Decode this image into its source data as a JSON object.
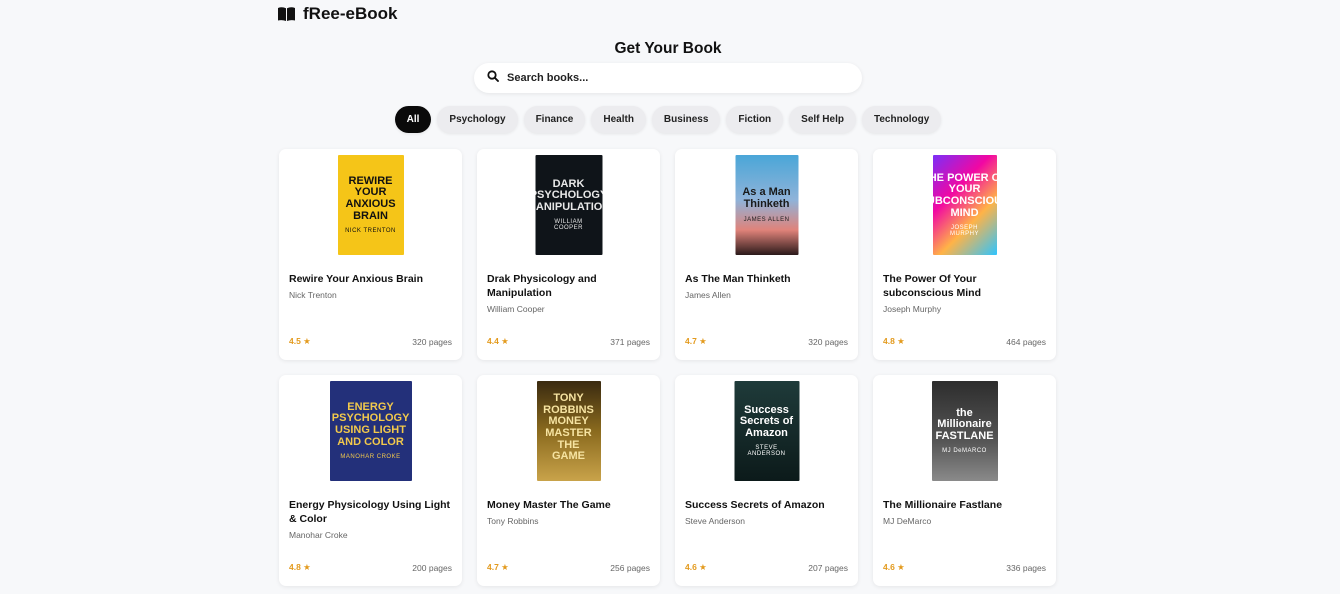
{
  "brand": {
    "name": "fRee-eBook",
    "icon": "book-open-icon"
  },
  "header": {
    "title": "Get Your Book"
  },
  "search": {
    "placeholder": "Search books...",
    "icon": "search-icon"
  },
  "filters": [
    "All",
    "Psychology",
    "Finance",
    "Health",
    "Business",
    "Fiction",
    "Self Help",
    "Technology"
  ],
  "active_filter": "All",
  "books": [
    {
      "title": "Rewire Your Anxious Brain",
      "author": "Nick Trenton",
      "rating": "4.5 ★",
      "pages": "320 pages",
      "cover": {
        "text": "REWIRE YOUR ANXIOUS BRAIN",
        "author": "NICK TRENTON",
        "bg": "#f5c518",
        "fg": "#111111"
      }
    },
    {
      "title": "Drak Physicology and Manipulation",
      "author": "William Cooper",
      "rating": "4.4 ★",
      "pages": "371 pages",
      "cover": {
        "text": "DARK PSYCHOLOGY MANIPULATION",
        "author": "WILLIAM COOPER",
        "bg": "#0f1419",
        "fg": "#e8e8e8"
      }
    },
    {
      "title": "As The Man Thinketh",
      "author": "James Allen",
      "rating": "4.7 ★",
      "pages": "320 pages",
      "cover": {
        "text": "As a Man Thinketh",
        "author": "JAMES ALLEN",
        "bg": "linear-gradient(180deg,#4aa6d8 0%,#8fb3d9 45%,#e0837a 75%,#2b1a1a 100%)",
        "fg": "#1a1a1a"
      }
    },
    {
      "title": "The Power Of Your subconscious Mind",
      "author": "Joseph Murphy",
      "rating": "4.8 ★",
      "pages": "464 pages",
      "cover": {
        "text": "THE POWER OF YOUR SUBCONSCIOUS MIND",
        "author": "JOSEPH MURPHY",
        "bg": "linear-gradient(135deg,#7b2ff7 0%,#f107a3 35%,#ffb347 65%,#2ec4ff 100%)",
        "fg": "#ffffff"
      }
    },
    {
      "title": "Energy Physicology Using Light & Color",
      "author": "Manohar Croke",
      "rating": "4.8 ★",
      "pages": "200 pages",
      "cover": {
        "text": "ENERGY PSYCHOLOGY USING LIGHT AND COLOR",
        "author": "MANOHAR CROKE",
        "bg": "#23307a",
        "fg": "#f2c94c"
      }
    },
    {
      "title": "Money Master The Game",
      "author": "Tony Robbins",
      "rating": "4.7 ★",
      "pages": "256 pages",
      "cover": {
        "text": "TONY ROBBINS MONEY MASTER THE GAME",
        "author": "",
        "bg": "linear-gradient(180deg,#3a2a10 0%,#8a6a1e 50%,#c9a34a 100%)",
        "fg": "#f6e3a1"
      }
    },
    {
      "title": "Success Secrets of Amazon",
      "author": "Steve Anderson",
      "rating": "4.6 ★",
      "pages": "207 pages",
      "cover": {
        "text": "Success Secrets of Amazon",
        "author": "STEVE ANDERSON",
        "bg": "linear-gradient(180deg,#1f3b3a 0%,#0c1a1a 100%)",
        "fg": "#ffffff"
      }
    },
    {
      "title": "The Millionaire Fastlane",
      "author": "MJ DeMarco",
      "rating": "4.6 ★",
      "pages": "336 pages",
      "cover": {
        "text": "the Millionaire FASTLANE",
        "author": "MJ DeMARCO",
        "bg": "linear-gradient(180deg,#2d2d2d 0%,#555555 60%,#8a8a8a 100%)",
        "fg": "#ffffff"
      }
    }
  ]
}
